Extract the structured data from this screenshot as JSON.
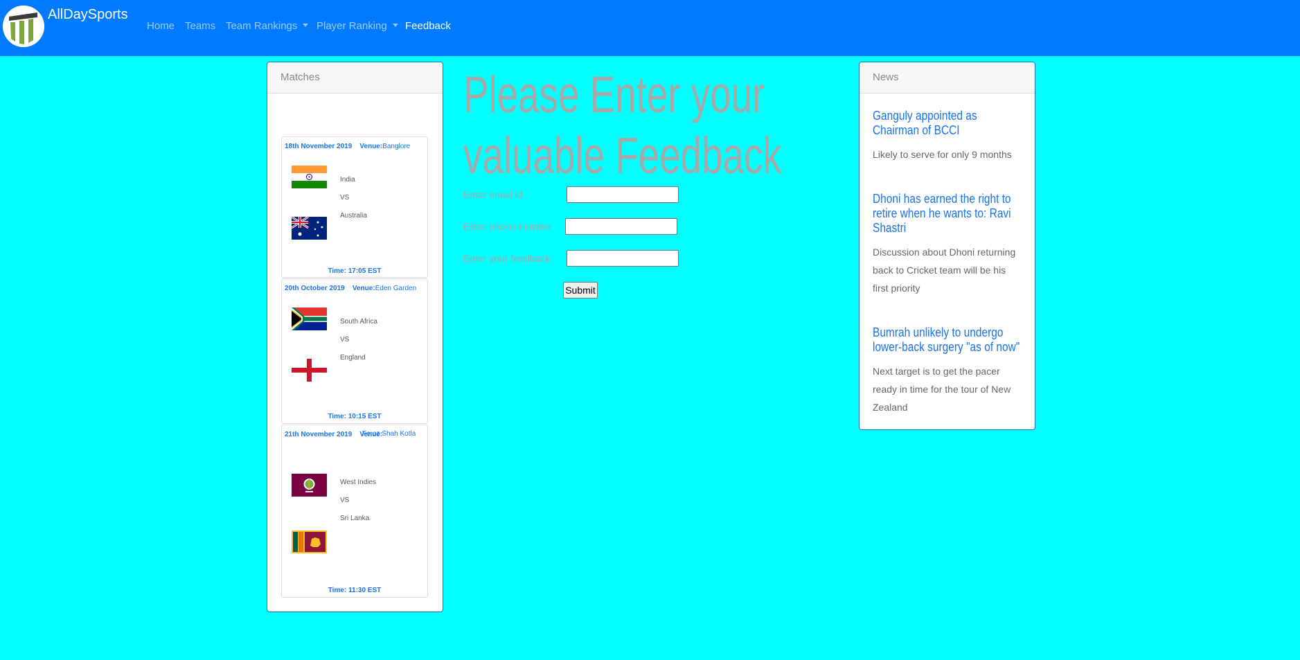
{
  "navbar": {
    "brand": "AllDaySports",
    "items": [
      {
        "label": "Home"
      },
      {
        "label": "Teams"
      },
      {
        "label": "Team Rankings"
      },
      {
        "label": "Player Ranking"
      },
      {
        "label": "Feedback"
      }
    ],
    "bg_color": "#007bff"
  },
  "matches": {
    "header": "Matches",
    "items": [
      {
        "date": "18th November 2019",
        "venue_label": "Venue:",
        "venue": "Banglore",
        "team1": "India",
        "vs": "VS",
        "team2": "Australia",
        "time": "Time: 17:05 EST",
        "flag1": "india-flag-icon",
        "flag2": "australia-flag-icon"
      },
      {
        "date": "20th October 2019",
        "venue_label": "Venue:",
        "venue": "Eden Garden",
        "team1": "South Africa",
        "vs": "VS",
        "team2": "England",
        "time": "Time: 10:15 EST",
        "flag1": "south-africa-flag-icon",
        "flag2": "england-flag-icon"
      },
      {
        "date": "21th November 2019",
        "venue_label": "Venue:",
        "venue": "Feroz Shah Kotla",
        "team1": "West Indies",
        "vs": "VS",
        "team2": "Sri Lanka",
        "time": "Time: 11:30 EST",
        "flag1": "west-indies-flag-icon",
        "flag2": "sri-lanka-flag-icon"
      }
    ]
  },
  "feedback": {
    "title_line1": "Please Enter your",
    "title_line2": "valuable Feedback",
    "email_label": "Enter email id",
    "email_value": "",
    "phone_label": "Enter phone number",
    "phone_value": "",
    "feedback_label": "Enter your feedback",
    "feedback_value": "",
    "submit_label": "Submit"
  },
  "news": {
    "header": "News",
    "items": [
      {
        "title": "Ganguly appointed as Chairman of BCCI",
        "desc": "Likely to serve for only 9 months"
      },
      {
        "title": "Dhoni has earned the right to retire when he wants to: Ravi Shastri",
        "desc": "Discussion about Dhoni returning back to Cricket team will be his first priority"
      },
      {
        "title": "Bumrah unlikely to undergo lower-back surgery \"as of now\"",
        "desc": "Next target is to get the pacer ready in time for the tour of New Zealand"
      }
    ]
  },
  "colors": {
    "page_bg": "#00ffff",
    "accent": "#1a73e8",
    "muted_text": "#a8a8a8"
  }
}
